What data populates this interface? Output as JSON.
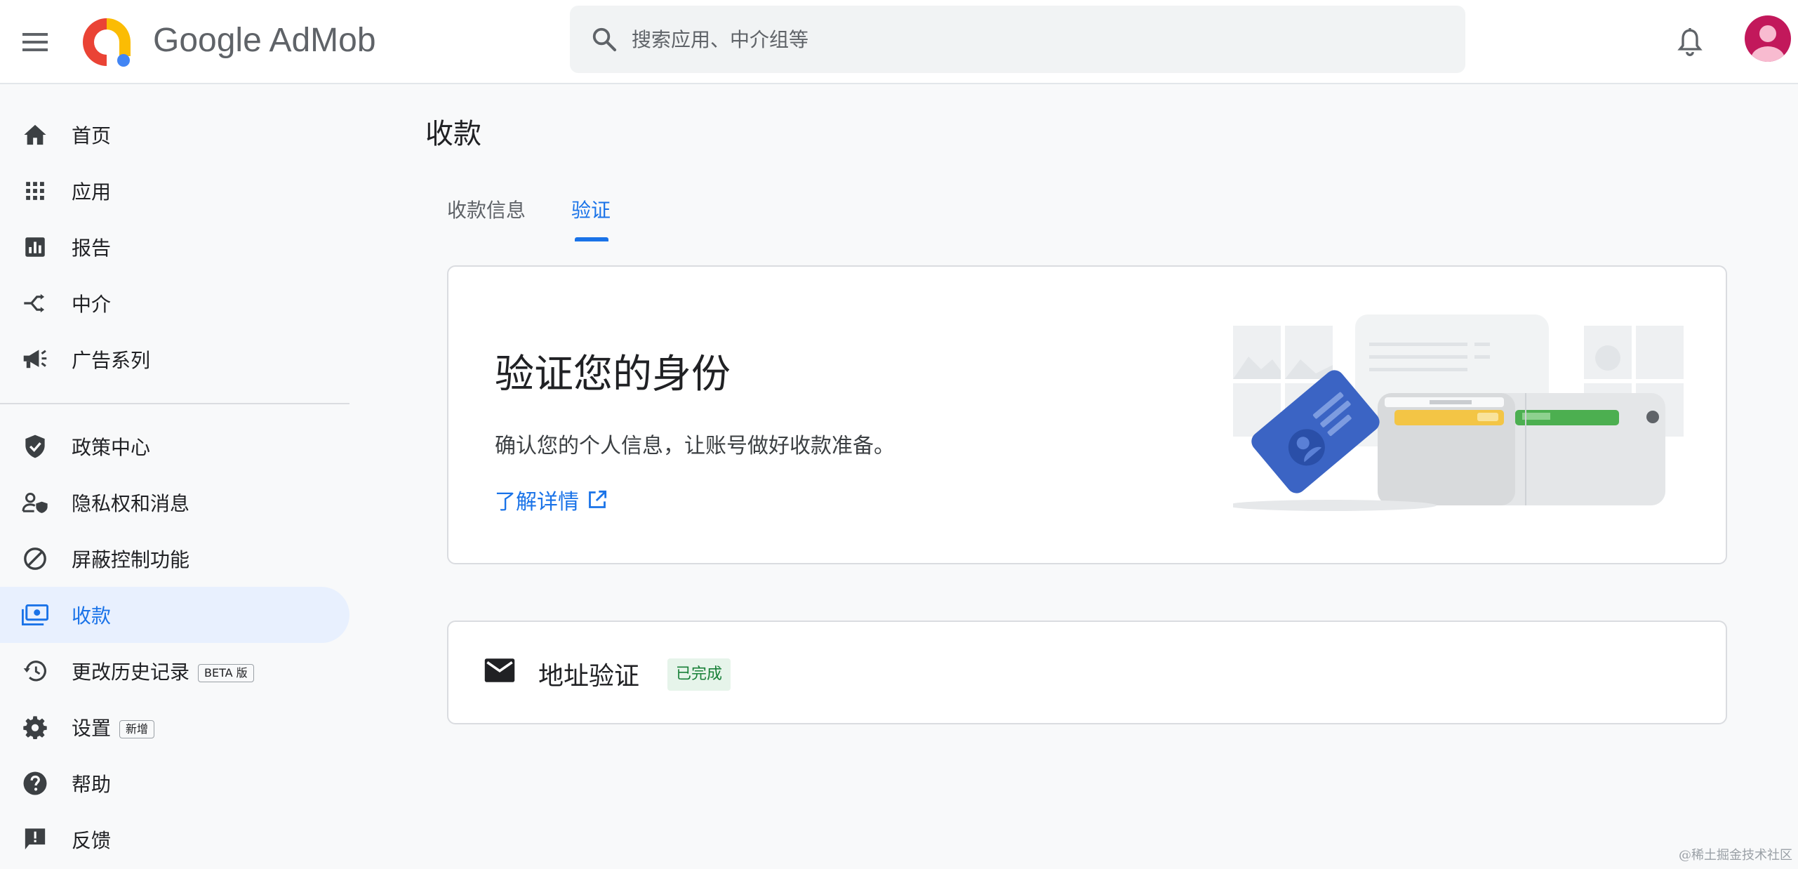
{
  "header": {
    "brand": "Google AdMob",
    "search_placeholder": "搜索应用、中介组等"
  },
  "sidebar": {
    "items": [
      {
        "label": "首页",
        "icon": "home-icon"
      },
      {
        "label": "应用",
        "icon": "apps-grid-icon"
      },
      {
        "label": "报告",
        "icon": "report-chart-icon"
      },
      {
        "label": "中介",
        "icon": "mediation-icon"
      },
      {
        "label": "广告系列",
        "icon": "campaign-megaphone-icon"
      },
      {
        "label": "政策中心",
        "icon": "policy-shield-icon"
      },
      {
        "label": "隐私权和消息",
        "icon": "privacy-person-icon"
      },
      {
        "label": "屏蔽控制功能",
        "icon": "block-icon"
      },
      {
        "label": "收款",
        "icon": "payments-icon",
        "active": true
      },
      {
        "label": "更改历史记录",
        "icon": "history-icon",
        "badge": "BETA 版"
      },
      {
        "label": "设置",
        "icon": "settings-gear-icon",
        "badge": "新增"
      },
      {
        "label": "帮助",
        "icon": "help-icon"
      },
      {
        "label": "反馈",
        "icon": "feedback-icon"
      }
    ]
  },
  "main": {
    "page_title": "收款",
    "tabs": [
      {
        "label": "收款信息",
        "active": false
      },
      {
        "label": "验证",
        "active": true
      }
    ],
    "verify_card": {
      "title": "验证您的身份",
      "description": "确认您的个人信息，让账号做好收款准备。",
      "link": "了解详情"
    },
    "address_card": {
      "label": "地址验证",
      "status": "已完成"
    }
  },
  "watermark": "@稀土掘金技术社区",
  "colors": {
    "accent": "#1a73e8",
    "active_bg": "#e8f0fe",
    "success_text": "#188038",
    "success_bg": "#e6f4ea"
  }
}
